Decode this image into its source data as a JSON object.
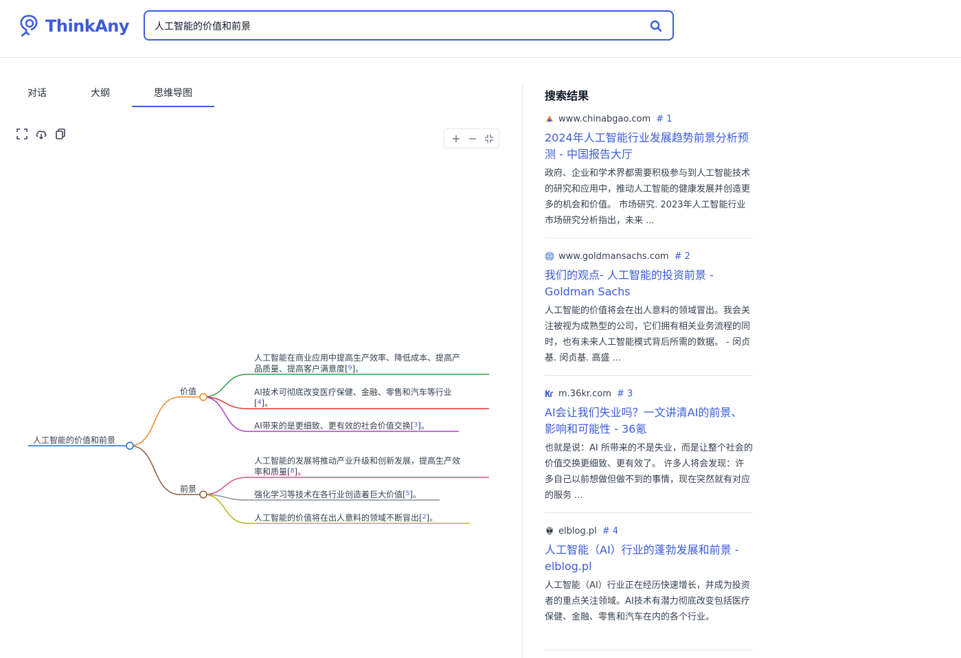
{
  "header": {
    "logo_text": "ThinkAny",
    "search_value": "人工智能的价值和前景"
  },
  "tabs": [
    {
      "label": "对话",
      "active": false
    },
    {
      "label": "大纲",
      "active": false
    },
    {
      "label": "思维导图",
      "active": true
    }
  ],
  "toolbar": {
    "icons": [
      "fullscreen-icon",
      "cloud-download-icon",
      "copy-icon"
    ],
    "zoom_icons": [
      "zoom-in-icon",
      "zoom-out-icon",
      "fit-screen-icon"
    ]
  },
  "mindmap": {
    "root": "人工智能的价值和前景",
    "branches": [
      {
        "label": "价值",
        "color": "#f08a24",
        "children": [
          {
            "lines": [
              "人工智能在商业应用中提高生产效率、降低成本、提高产",
              "品质量、提高客户满意度["
            ],
            "cite": "9",
            "tail": "]。",
            "color": "#2f9e44"
          },
          {
            "lines": [
              "AI技术可彻底改变医疗保健、金融、零售和汽车等行业",
              "["
            ],
            "cite": "4",
            "tail": "]。",
            "color": "#e03131"
          },
          {
            "lines": [
              "AI带来的是更细致、更有效的社会价值交换["
            ],
            "cite": "3",
            "tail": "]。",
            "color": "#ae3ec9"
          }
        ]
      },
      {
        "label": "前景",
        "color": "#8c5a3c",
        "children": [
          {
            "lines": [
              "人工智能的发展将推动产业升级和创新发展，提高生产效",
              "率和质量["
            ],
            "cite": "8",
            "tail": "]。",
            "color": "#e64980"
          },
          {
            "lines": [
              "强化学习等技术在各行业创造着巨大价值["
            ],
            "cite": "5",
            "tail": "]。",
            "color": "#868e96"
          },
          {
            "lines": [
              "人工智能的价值将在出人意料的领域不断冒出["
            ],
            "cite": "2",
            "tail": "]。",
            "color": "#c0b218"
          }
        ]
      }
    ]
  },
  "results": {
    "title": "搜索结果",
    "items": [
      {
        "source": "www.chinabgao.com",
        "num": "# 1",
        "favicon": "chinabgao-favicon-icon",
        "title": "2024年人工智能行业发展趋势前景分析预测 - 中国报告大厅",
        "snippet": "政府、企业和学术界都需要积极参与到人工智能技术的研究和应用中，推动人工智能的健康发展并创造更多的机会和价值。 市场研究. 2023年人工智能行业市场研究分析指出，未来 ..."
      },
      {
        "source": "www.goldmansachs.com",
        "num": "# 2",
        "favicon": "goldmansachs-favicon-icon",
        "title": "我们的观点- 人工智能的投资前景 - Goldman Sachs",
        "snippet": "人工智能的价值将会在出人意料的领域冒出。我会关注被视为成熟型的公司，它们拥有相关业务流程的同时，也有未来人工智能模式背后所需的数据。 - 闵贞基. 闵贞基. 高盛 ..."
      },
      {
        "source": "m.36kr.com",
        "num": "# 3",
        "favicon": "36kr-favicon-icon",
        "title": "AI会让我们失业吗？一文讲清AI的前景、影响和可能性 - 36氪",
        "snippet": "也就是说：AI 所带来的不是失业，而是让整个社会的价值交换更细致、更有效了。 许多人将会发现：许多自己以前想做但做不到的事情，现在突然就有对应的服务 ..."
      },
      {
        "source": "elblog.pl",
        "num": "# 4",
        "favicon": "alien-favicon-icon",
        "title": "人工智能（AI）行业的蓬勃发展和前景 - elblog.pl",
        "snippet": "人工智能（AI）行业正在经历快速增长，并成为投资者的重点关注领域。AI技术有潜力彻底改变包括医疗保健、金融、零售和汽车在内的各个行业。"
      }
    ]
  }
}
